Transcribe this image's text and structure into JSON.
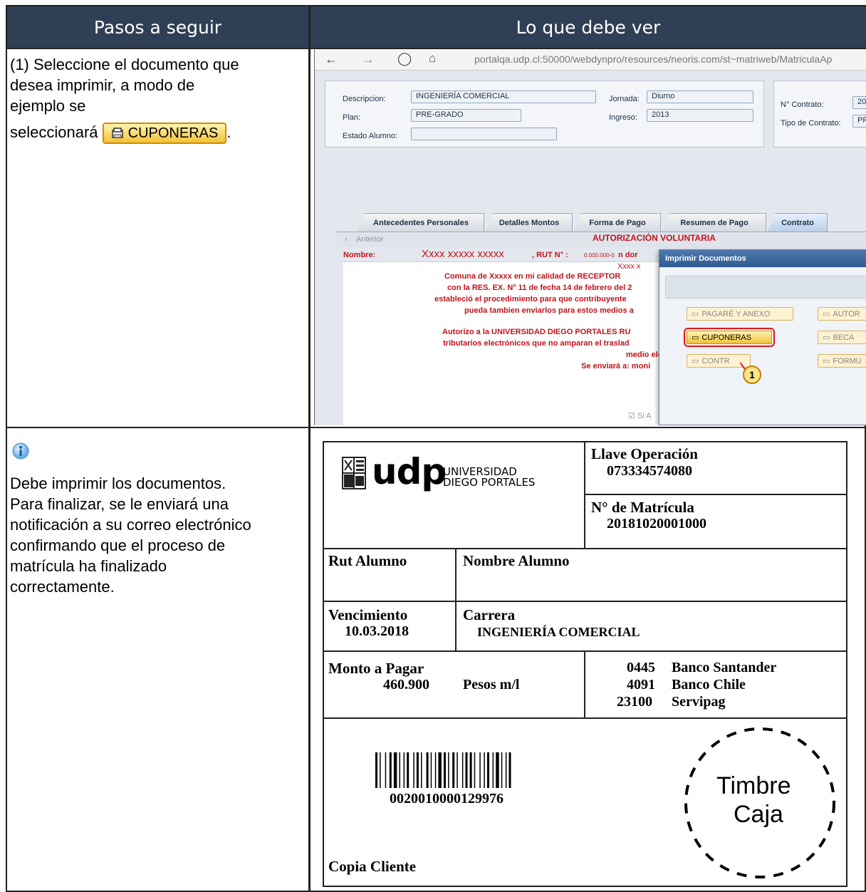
{
  "header": {
    "col1": "Pasos a seguir",
    "col2": "Lo que debe ver"
  },
  "step1": {
    "text_line1": "(1) Seleccione el documento que",
    "text_line2": "desea imprimir, a modo de",
    "text_line3": "ejemplo se",
    "text_line4": "seleccionará",
    "button_label": "CUPONERAS",
    "trailing": "."
  },
  "step2": {
    "icon": "info-icon",
    "lines": [
      "Debe imprimir los documentos.",
      "Para finalizar, se le enviará una",
      "notificación a su correo electrónico",
      "confirmando que el proceso de",
      "matrícula ha finalizado",
      "correctamente."
    ]
  },
  "browser": {
    "url": "portalqa.udp.cl:50000/webdynpro/resources/neoris.com/st~matriweb/MatriculaAp",
    "url_host_bold": "udp.cl",
    "fields": {
      "descripcion_label": "Descripcion:",
      "descripcion_value": "INGENIERÍA COMERCIAL",
      "plan_label": "Plan:",
      "plan_value": "PRE-GRADO",
      "estado_label": "Estado Alumno:",
      "jornada_label": "Jornada:",
      "jornada_value": "Diurno",
      "ingreso_label": "Ingreso:",
      "ingreso_value": "2013",
      "contrato_label": "N° Contrato:",
      "contrato_value": "20",
      "tipo_label": "Tipo de Contrato:",
      "tipo_value": "PF"
    },
    "tabs": [
      "Antecedentes Personales",
      "Detalles Montos",
      "Forma de Pago",
      "Resumen de Pago",
      "Contrato"
    ],
    "anterior": "Anterior",
    "doc": {
      "title": "AUTORIZACIÓN VOLUNTARIA",
      "nombre_label": "Nombre:",
      "nombre_value": "Xxxx xxxxx xxxxx",
      "rut": ", RUT N° :",
      "rut_val": "0.000.000-0",
      "n_dor": "n dor",
      "xxxx": "Xxxx x",
      "line1": "Comuna de     Xxxxx     en mi calidad de RECEPTOR",
      "line2": "con la RES. EX. N° 11 de fecha 14 de febrero del 2",
      "line3": "estableció el procedimiento para que contribuyente",
      "line4": "pueda tambien enviarlos para estos medios a",
      "line5": "Autorizo a la UNIVERSIDAD DIEGO PORTALES RU",
      "line6": "tributarios electrónicos que no amparan el traslad",
      "line7": "medio ele",
      "line8": "Se enviará a: moni",
      "check": "Si A"
    },
    "dialog": {
      "title": "Imprimir Documentos",
      "buttons": [
        "PAGARÉ Y ANEXO",
        "AUTOR",
        "CUPONERAS",
        "BECA",
        "CONTR",
        "FORMU"
      ],
      "callout": "1"
    }
  },
  "coupon": {
    "logo_text": "udp",
    "logo_sub1": "UNIVERSIDAD",
    "logo_sub2": "DIEGO PORTALES",
    "llave_label": "Llave Operación",
    "llave_value": "073334574080",
    "matricula_label": "N° de Matrícula",
    "matricula_value": "20181020001000",
    "rut_label": "Rut Alumno",
    "nombre_label": "Nombre Alumno",
    "venc_label": "Vencimiento",
    "venc_value": "10.03.2018",
    "carrera_label": "Carrera",
    "carrera_value": "INGENIERÍA COMERCIAL",
    "monto_label": "Monto a Pagar",
    "monto_value": "460.900",
    "monto_unit": "Pesos m/l",
    "banks": [
      {
        "code": "0445",
        "name": "Banco Santander"
      },
      {
        "code": "4091",
        "name": "Banco Chile"
      },
      {
        "code": "23100",
        "name": "Servipag"
      }
    ],
    "barcode_number": "0020010000129976",
    "timbre1": "Timbre",
    "timbre2": "Caja",
    "copia": "Copia Cliente"
  }
}
